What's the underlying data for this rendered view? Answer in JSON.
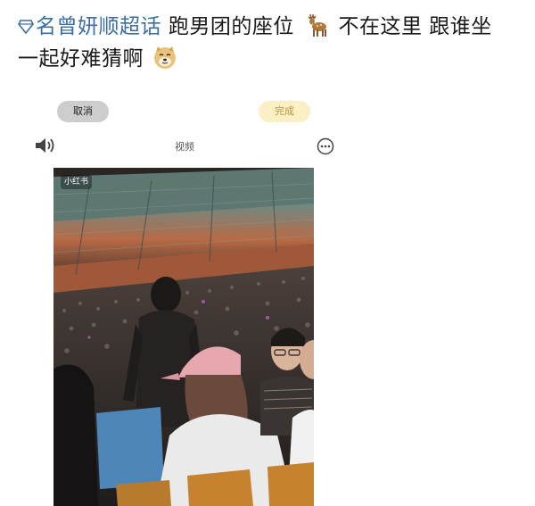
{
  "post": {
    "topic": "名曾妍顺超话",
    "line1_text": "跑男团的座位",
    "line1_text2": "不在这里 跟谁坐",
    "line2_text": "一起好难猜啊",
    "deer_emoji": "deer-emoji",
    "doge_emoji": "doge-emoji"
  },
  "controls": {
    "cancel_label": "取消",
    "done_label": "完成",
    "video_label": "视频"
  },
  "video": {
    "badge_label": "小红书"
  },
  "colors": {
    "topic_link": "#3a6ea5",
    "done_bg": "#fbf0c5",
    "cancel_bg": "#cdcdcd"
  }
}
